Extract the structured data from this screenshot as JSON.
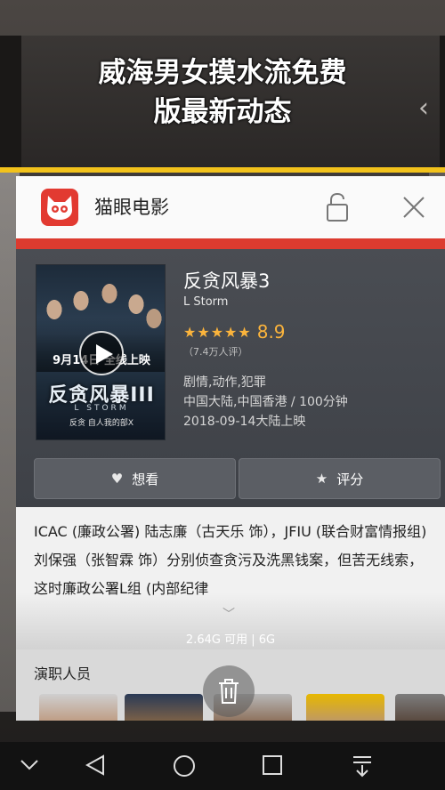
{
  "overlay": {
    "title_line1": "威海男⁠⁠女⁠摸⁠水流免费",
    "title_line2": "版最新动态"
  },
  "app": {
    "name": "猫眼电影"
  },
  "movie": {
    "title": "反贪风暴3",
    "english_title": "L Storm",
    "stars": "★★★★★",
    "score": "8.9",
    "votes": "（7.4万人评）",
    "genre": "剧情,动作,犯罪",
    "region_duration": "中国大陆,中国香港 / 100分钟",
    "release": "2018-09-14大陆上映",
    "poster": {
      "title": "反贪风暴III",
      "date_text": "9月14日 全线上映",
      "english": "L STORM",
      "tagline": "反贪 自人我的部X"
    }
  },
  "buttons": {
    "want_label": "想看",
    "rate_label": "评分"
  },
  "description": {
    "text": "ICAC (廉政公署) 陆志廉（古天乐 饰），JFIU (联合财富情报组) 刘保强（张智霖 饰）分别侦查贪污及洗黑钱案，但苦无线索，这时廉政公署L组 (内部纪律"
  },
  "memory": {
    "text": "2.64G 可用 | 6G"
  },
  "cast": {
    "label": "演职人员"
  },
  "colors": {
    "accent_red": "#dc3b2f",
    "star_yellow": "#fbb43c",
    "overlay_line": "#f2c21b"
  },
  "icons": [
    "lock-icon",
    "close-icon",
    "play-icon",
    "heart-icon",
    "star-icon",
    "chevron-down-icon",
    "trash-icon",
    "nav-collapse-icon",
    "nav-back-icon",
    "nav-home-icon",
    "nav-recents-icon",
    "nav-notifications-icon"
  ]
}
